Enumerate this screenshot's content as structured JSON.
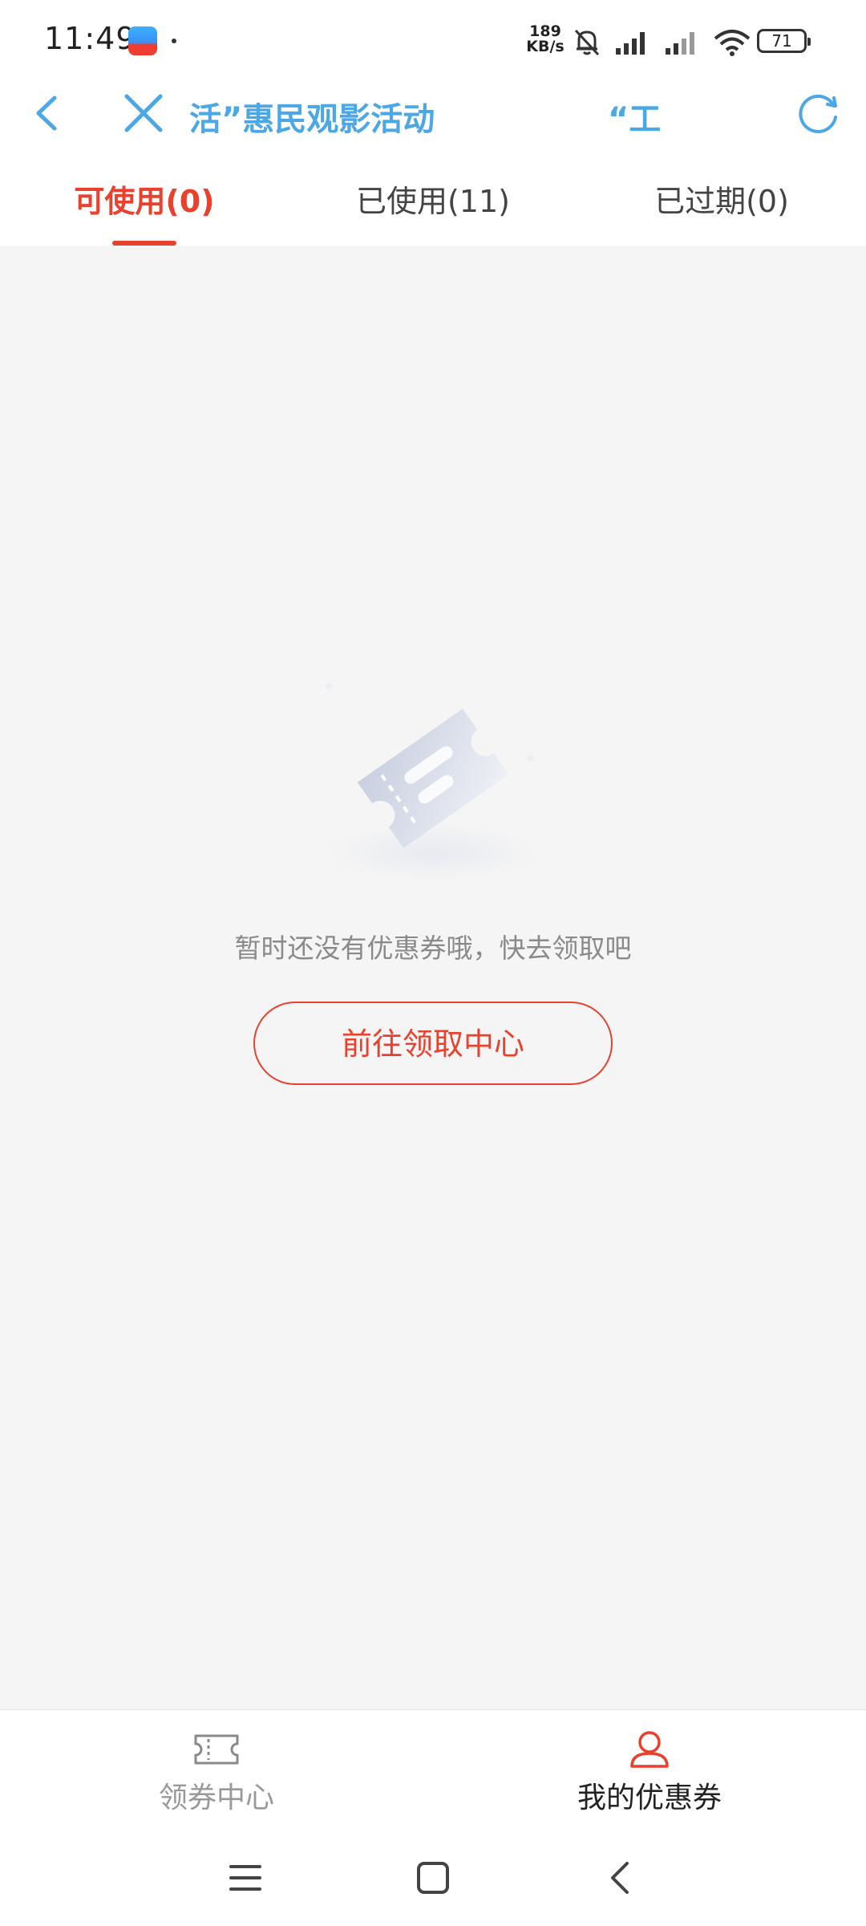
{
  "status_bar": {
    "time": "11:49",
    "net_speed_value": "189",
    "net_speed_unit": "KB/s",
    "battery": "71"
  },
  "nav": {
    "title": "活”惠民观影活动",
    "title_secondary": "“工",
    "accent_color": "#4ba7e6"
  },
  "tabs": [
    {
      "label": "可使用(0)",
      "active": true
    },
    {
      "label": "已使用(11)",
      "active": false
    },
    {
      "label": "已过期(0)",
      "active": false
    }
  ],
  "empty_state": {
    "message": "暂时还没有优惠券哦，快去领取吧",
    "button_label": "前往领取中心",
    "accent_color": "#e8412e"
  },
  "bottom_tabs": [
    {
      "label": "领券中心",
      "icon": "ticket-icon",
      "active": false
    },
    {
      "label": "我的优惠券",
      "icon": "user-icon",
      "active": true
    }
  ],
  "system_nav": {
    "icons": [
      "menu-icon",
      "home-icon",
      "back-icon"
    ]
  }
}
